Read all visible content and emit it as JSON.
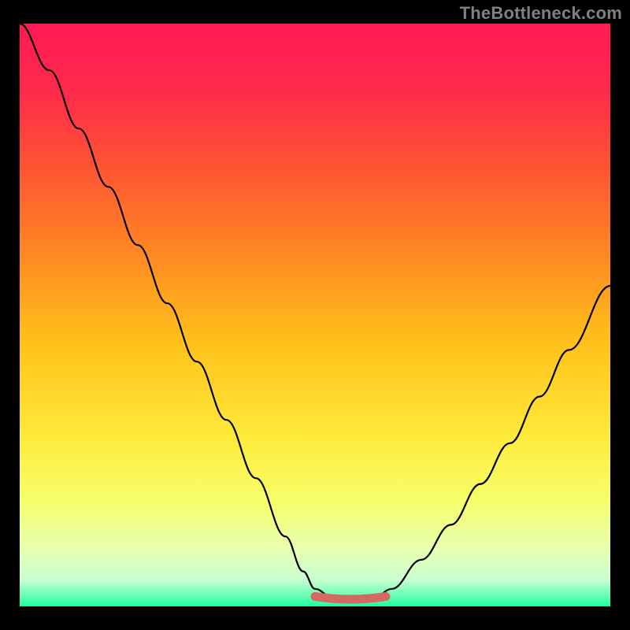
{
  "watermark": "TheBottleneck.com",
  "colors": {
    "frame": "#000000",
    "watermark": "#808080",
    "curve": "#000000",
    "plateau": "#d46a5f",
    "gradient_stops": [
      {
        "offset": 0.0,
        "color": "#ff1a55"
      },
      {
        "offset": 0.12,
        "color": "#ff2b4a"
      },
      {
        "offset": 0.25,
        "color": "#ff5533"
      },
      {
        "offset": 0.4,
        "color": "#ff8a22"
      },
      {
        "offset": 0.55,
        "color": "#ffc21a"
      },
      {
        "offset": 0.7,
        "color": "#ffe838"
      },
      {
        "offset": 0.82,
        "color": "#f7ff6a"
      },
      {
        "offset": 0.9,
        "color": "#e8ffb0"
      },
      {
        "offset": 0.955,
        "color": "#c8ffd0"
      },
      {
        "offset": 0.985,
        "color": "#59ffb0"
      },
      {
        "offset": 1.0,
        "color": "#1dfd9d"
      }
    ]
  },
  "chart_data": {
    "type": "line",
    "title": "",
    "xlabel": "",
    "ylabel": "",
    "xlim": [
      0,
      100
    ],
    "ylim": [
      0,
      100
    ],
    "grid": false,
    "legend": false,
    "series": [
      {
        "name": "bottleneck-curve",
        "x": [
          0,
          5,
          10,
          15,
          20,
          25,
          30,
          35,
          40,
          45,
          48,
          50,
          53,
          56,
          58,
          60,
          63,
          68,
          73,
          78,
          83,
          88,
          93,
          100
        ],
        "y": [
          100,
          92,
          82,
          72,
          62,
          52,
          42,
          32,
          22,
          12,
          6,
          3,
          1.5,
          1.2,
          1.2,
          1.5,
          3,
          8,
          14,
          21,
          28,
          36,
          44,
          55
        ]
      }
    ],
    "annotations": [
      {
        "type": "plateau",
        "x_start": 50,
        "x_end": 62,
        "y": 1.3
      }
    ]
  }
}
